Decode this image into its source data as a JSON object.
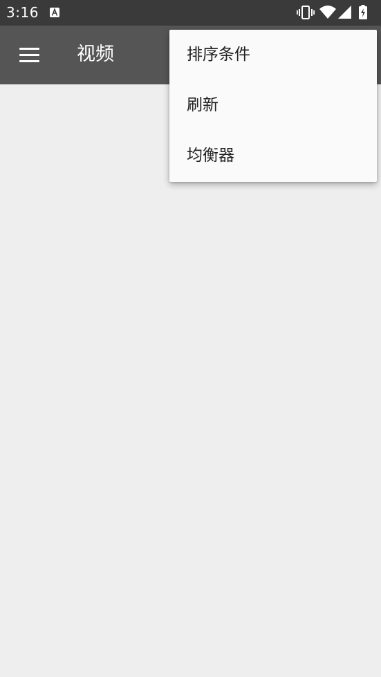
{
  "status_bar": {
    "time": "3:16",
    "icons": [
      "notification-a-icon",
      "vibrate-icon",
      "wifi-icon",
      "signal-icon",
      "battery-charging-icon"
    ]
  },
  "app_bar": {
    "menu_icon": "hamburger-menu-icon",
    "title": "视频"
  },
  "overflow_menu": {
    "items": [
      {
        "label": "排序条件"
      },
      {
        "label": "刷新"
      },
      {
        "label": "均衡器"
      }
    ]
  },
  "colors": {
    "status_bar": "#3a3a3a",
    "app_bar": "#555555",
    "background": "#eeeeee",
    "menu_background": "#fafafa"
  }
}
